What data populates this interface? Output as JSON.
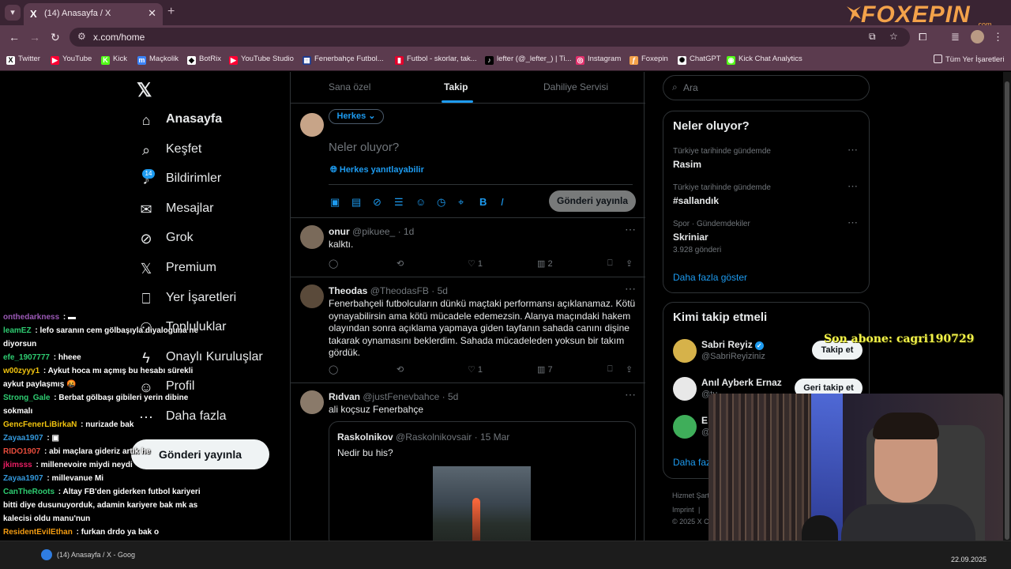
{
  "browser": {
    "tab_title": "(14) Anasayfa / X",
    "url": "x.com/home",
    "bookmarks": [
      {
        "label": "Twitter",
        "color": "#ffffff",
        "glyph": "X"
      },
      {
        "label": "YouTube",
        "color": "#ff0033",
        "glyph": "▶"
      },
      {
        "label": "Kick",
        "color": "#53fc18",
        "glyph": "K"
      },
      {
        "label": "Maçkolik",
        "color": "#3b82f6",
        "glyph": "m"
      },
      {
        "label": "BotRix",
        "color": "#ffffff",
        "glyph": "◆"
      },
      {
        "label": "YouTube Studio",
        "color": "#ff0033",
        "glyph": "▶"
      },
      {
        "label": "Fenerbahçe Futbol...",
        "color": "#1d3b8f",
        "glyph": "▦"
      },
      {
        "label": "Futbol - skorlar, tak...",
        "color": "#e4002b",
        "glyph": "▮"
      },
      {
        "label": "lefter (@_lefter_) | Ti...",
        "color": "#000000",
        "glyph": "♪"
      },
      {
        "label": "Instagram",
        "color": "#e1306c",
        "glyph": "◎"
      },
      {
        "label": "Foxepin",
        "color": "#f3a24a",
        "glyph": "ƒ"
      },
      {
        "label": "ChatGPT",
        "color": "#ffffff",
        "glyph": "✺"
      },
      {
        "label": "Kick Chat Analytics",
        "color": "#53fc18",
        "glyph": "◉"
      }
    ],
    "all_bookmarks": "Tüm Yer İşaretleri"
  },
  "watermark": {
    "brand": "FOXEPIN",
    "sub": ".com"
  },
  "nav": {
    "items": [
      {
        "label": "Anasayfa",
        "icon": "home-icon"
      },
      {
        "label": "Keşfet",
        "icon": "search-icon"
      },
      {
        "label": "Bildirimler",
        "icon": "bell-icon"
      },
      {
        "label": "Mesajlar",
        "icon": "mail-icon"
      },
      {
        "label": "Grok",
        "icon": "grok-icon"
      },
      {
        "label": "Premium",
        "icon": "x-icon"
      },
      {
        "label": "Yer İşaretleri",
        "icon": "bookmark-icon"
      },
      {
        "label": "Topluluklar",
        "icon": "communities-icon"
      },
      {
        "label": "Onaylı Kuruluşlar",
        "icon": "lightning-icon"
      },
      {
        "label": "Profil",
        "icon": "profile-icon"
      },
      {
        "label": "Daha fazla",
        "icon": "more-icon"
      }
    ],
    "notification_count": "14",
    "post_button": "Gönderi yayınla"
  },
  "feed": {
    "tabs": [
      "Sana özel",
      "Takip",
      "Dahiliye Servisi"
    ],
    "active_tab": "Takip",
    "compose": {
      "audience": "Herkes",
      "placeholder": "Neler oluyor?",
      "reply_setting": "Herkes yanıtlayabilir",
      "post_button": "Gönderi yayınla"
    },
    "tweets": [
      {
        "name": "onur",
        "handle": "@pikuee_",
        "time": "1d",
        "text": "kalktı.",
        "likes": "1",
        "views": "2"
      },
      {
        "name": "Theodas",
        "handle": "@TheodasFB",
        "time": "5d",
        "text": "Fenerbahçeli futbolcuların dünkü maçtaki performansı açıklanamaz. Kötü oynayabilirsin ama kötü mücadele edemezsin. Alanya maçındaki hakem olayından sonra açıklama yapmaya giden tayfanın sahada canını dişine takarak oynamasını beklerdim. Sahada mücadeleden yoksun bir takım gördük.",
        "likes": "1",
        "views": "7"
      },
      {
        "name": "Rıdvan",
        "handle": "@justFenevbahce",
        "time": "5d",
        "text": "ali koçsuz Fenerbahçe",
        "quote": {
          "name": "Raskolnikov",
          "handle": "@Raskolnikovsair",
          "time": "15 Mar",
          "text": "Nedir bu his?"
        }
      }
    ]
  },
  "sidebar": {
    "search_placeholder": "Ara",
    "trends_title": "Neler oluyor?",
    "trends": [
      {
        "context": "Türkiye tarihinde gündemde",
        "title": "Rasim",
        "count": ""
      },
      {
        "context": "Türkiye tarihinde gündemde",
        "title": "#sallandık",
        "count": ""
      },
      {
        "context": "Spor · Gündemdekiler",
        "title": "Skriniar",
        "count": "3.928 gönderi"
      }
    ],
    "trends_more": "Daha fazla göster",
    "who_title": "Kimi takip etmeli",
    "who": [
      {
        "name": "Sabri Reyiz",
        "handle": "@SabriReyiziniz",
        "button": "Takip et"
      },
      {
        "name": "Anıl Ayberk Ernaz",
        "handle": "@tu",
        "button": "Geri takip et"
      },
      {
        "name": "E",
        "handle": "@",
        "button": ""
      }
    ],
    "who_more": "Daha faz",
    "footer": [
      "Hizmet Şart",
      "Imprint",
      "|",
      "© 2025 X C"
    ]
  },
  "stream": {
    "sub_alert": "Son abone: cagri190729",
    "chat": [
      {
        "user": "onthedarkness",
        "color": "#9b59b6",
        "text": "▬"
      },
      {
        "user": "leamEZ",
        "color": "#2ecc71",
        "text": "lefo saranın cem gölbaşıyla diyaloguna ne diyorsun"
      },
      {
        "user": "efe_1907777",
        "color": "#2ecc71",
        "text": "hheee"
      },
      {
        "user": "w00zyyy1",
        "color": "#f1c40f",
        "text": "Aykut hoca mı açmış bu hesabı sürekli aykut paylaşmış 🤬"
      },
      {
        "user": "Strong_Gale",
        "color": "#2ecc71",
        "text": "Berbat gölbaşı gibileri yerin dibine sokmalı"
      },
      {
        "user": "GencFenerLiBirkaN",
        "color": "#f1c40f",
        "text": "nurizade bak"
      },
      {
        "user": "Zayaa1907",
        "color": "#3498db",
        "text": "▣"
      },
      {
        "user": "RIDO1907",
        "color": "#e74c3c",
        "text": "abi maçlara gideriz artık he"
      },
      {
        "user": "jkimsss",
        "color": "#e91e63",
        "text": "millenevoire miydi neydi"
      },
      {
        "user": "Zayaa1907",
        "color": "#3498db",
        "text": "millevanue Mi"
      },
      {
        "user": "CanTheRoots",
        "color": "#2ecc71",
        "text": "Altay FB'den giderken futbol kariyeri bitti diye dusunuyorduk, adamin kariyere bak mk as kalecisi oldu manu'nun"
      },
      {
        "user": "ResidentEvilEthan",
        "color": "#f39c12",
        "text": "furkan drdo ya bak o sövüşüyodu mentlerde"
      }
    ]
  },
  "taskbar": {
    "window_label": "(14) Anasayfa / X - Goog",
    "date": "22.09.2025"
  },
  "colors": {
    "accent": "#1d9bf0",
    "chrome": "#5b3b4e",
    "tabbar": "#3a2433"
  }
}
